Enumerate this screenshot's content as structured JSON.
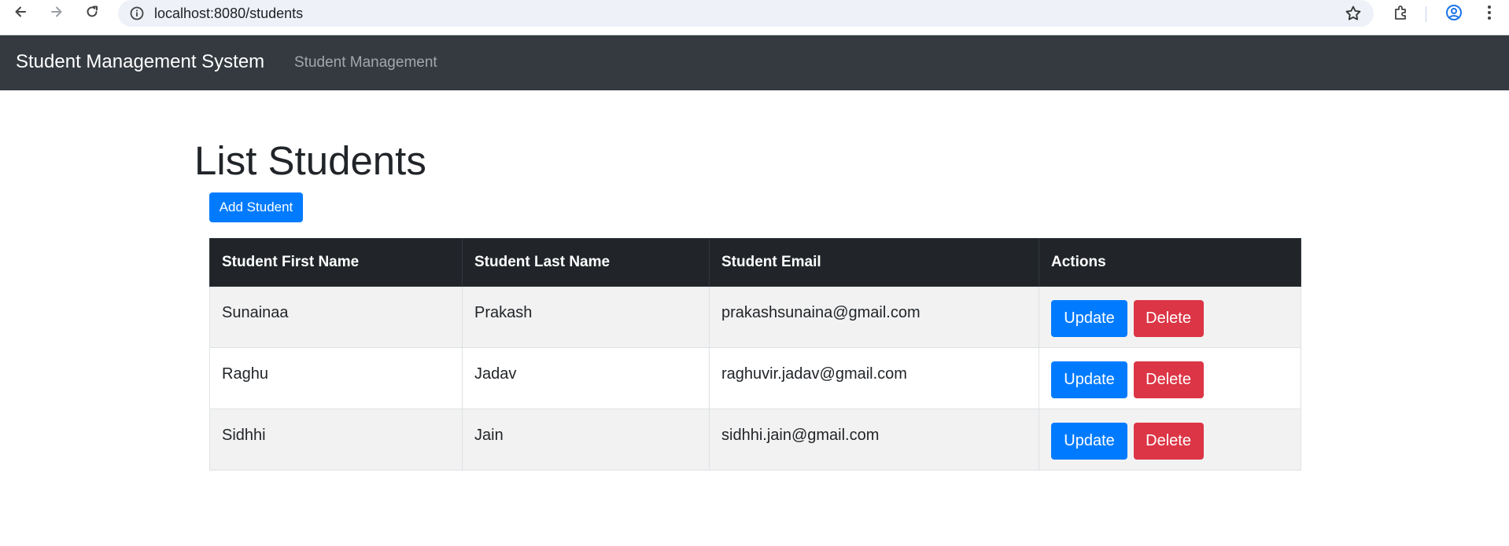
{
  "browser": {
    "url": "localhost:8080/students"
  },
  "navbar": {
    "brand": "Student Management System",
    "link": "Student Management"
  },
  "main": {
    "title": "List Students",
    "add_button": "Add Student"
  },
  "table": {
    "headers": [
      "Student First Name",
      "Student Last Name",
      "Student Email",
      "Actions"
    ],
    "rows": [
      {
        "first": "Sunainaa",
        "last": "Prakash",
        "email": "prakashsunaina@gmail.com"
      },
      {
        "first": "Raghu",
        "last": "Jadav",
        "email": "raghuvir.jadav@gmail.com"
      },
      {
        "first": "Sidhhi",
        "last": "Jain",
        "email": "sidhhi.jain@gmail.com"
      }
    ],
    "update_label": "Update",
    "delete_label": "Delete"
  },
  "colors": {
    "navbar": "#343a40",
    "primary": "#007bff",
    "danger": "#dc3545",
    "table_header": "#212529"
  },
  "icons": [
    "back-arrow-icon",
    "forward-arrow-icon",
    "reload-icon",
    "info-icon",
    "star-icon",
    "extensions-icon",
    "profile-icon",
    "more-vertical-icon"
  ]
}
